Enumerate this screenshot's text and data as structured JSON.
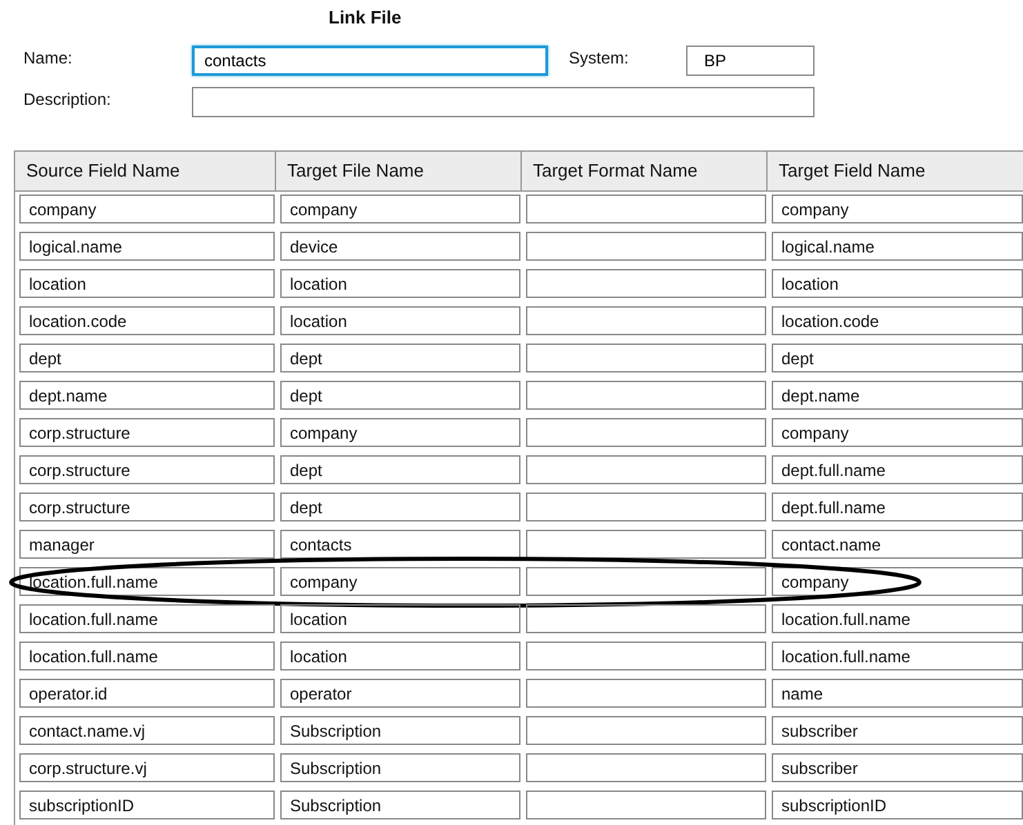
{
  "title": "Link File",
  "form": {
    "name_label": "Name:",
    "name_value": "contacts",
    "name_focused": true,
    "system_label": "System:",
    "system_value": "BP",
    "description_label": "Description:"
  },
  "table": {
    "columns": [
      "Source Field Name",
      "Target File Name",
      "Target Format Name",
      "Target Field Name"
    ],
    "rows": [
      {
        "cells": [
          "company",
          "company",
          "",
          "company"
        ],
        "circled": false
      },
      {
        "cells": [
          "logical.name",
          "device",
          "",
          "logical.name"
        ],
        "circled": false
      },
      {
        "cells": [
          "location",
          "location",
          "",
          "location"
        ],
        "circled": false
      },
      {
        "cells": [
          "location.code",
          "location",
          "",
          "location.code"
        ],
        "circled": false
      },
      {
        "cells": [
          "dept",
          "dept",
          "",
          "dept"
        ],
        "circled": false
      },
      {
        "cells": [
          "dept.name",
          "dept",
          "",
          "dept.name"
        ],
        "circled": false
      },
      {
        "cells": [
          "corp.structure",
          "company",
          "",
          "company"
        ],
        "circled": false
      },
      {
        "cells": [
          "corp.structure",
          "dept",
          "",
          "dept.full.name"
        ],
        "circled": false
      },
      {
        "cells": [
          "corp.structure",
          "dept",
          "",
          "dept.full.name"
        ],
        "circled": false
      },
      {
        "cells": [
          "manager",
          "contacts",
          "",
          "contact.name"
        ],
        "circled": false
      },
      {
        "cells": [
          "location.full.name",
          "company",
          "",
          "company"
        ],
        "circled": true
      },
      {
        "cells": [
          "location.full.name",
          "location",
          "",
          "location.full.name"
        ],
        "circled": false
      },
      {
        "cells": [
          "location.full.name",
          "location",
          "",
          "location.full.name"
        ],
        "circled": false
      },
      {
        "cells": [
          "operator.id",
          "operator",
          "",
          "name"
        ],
        "circled": false
      },
      {
        "cells": [
          "contact.name.vj",
          "Subscription",
          "",
          "subscriber"
        ],
        "circled": false
      },
      {
        "cells": [
          "corp.structure.vj",
          "Subscription",
          "",
          "subscriber"
        ],
        "circled": false
      },
      {
        "cells": [
          "subscriptionID",
          "Subscription",
          "",
          "subscriptionID"
        ],
        "circled": false
      }
    ]
  }
}
